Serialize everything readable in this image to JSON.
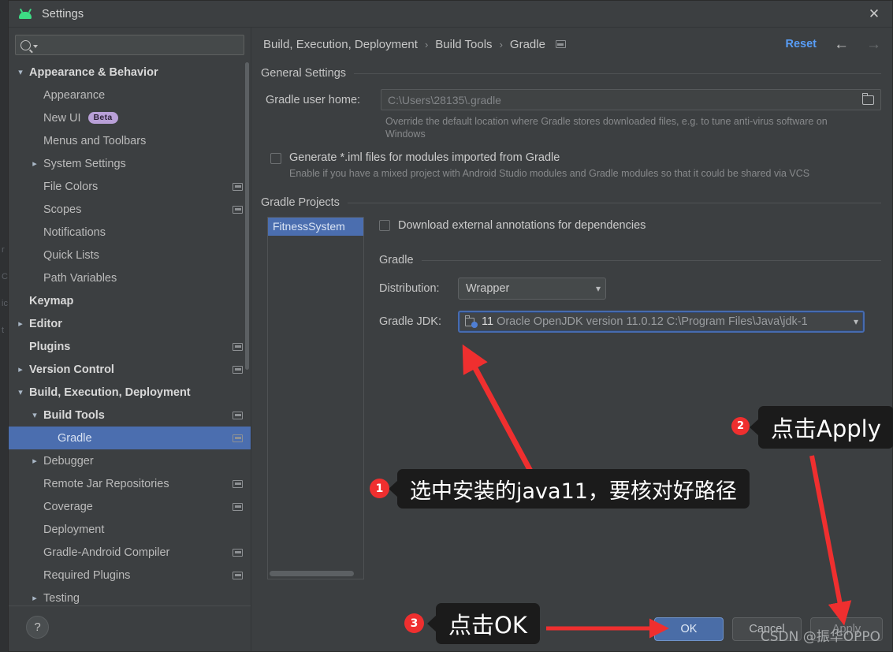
{
  "window": {
    "title": "Settings",
    "app_icon": "android-studio-icon",
    "close_icon": "close-icon"
  },
  "sidebar": {
    "search": {
      "placeholder": "",
      "value": "",
      "icon": "search-icon"
    },
    "items": [
      {
        "label": "Appearance & Behavior",
        "indent": 0,
        "arrow": "expanded",
        "bold": true,
        "cfg": false,
        "badge": ""
      },
      {
        "label": "Appearance",
        "indent": 1,
        "arrow": "none",
        "bold": false,
        "cfg": false,
        "badge": ""
      },
      {
        "label": "New UI",
        "indent": 1,
        "arrow": "none",
        "bold": false,
        "cfg": false,
        "badge": "Beta"
      },
      {
        "label": "Menus and Toolbars",
        "indent": 1,
        "arrow": "none",
        "bold": false,
        "cfg": false,
        "badge": ""
      },
      {
        "label": "System Settings",
        "indent": 1,
        "arrow": "collapsed",
        "bold": false,
        "cfg": false,
        "badge": ""
      },
      {
        "label": "File Colors",
        "indent": 1,
        "arrow": "none",
        "bold": false,
        "cfg": true,
        "badge": ""
      },
      {
        "label": "Scopes",
        "indent": 1,
        "arrow": "none",
        "bold": false,
        "cfg": true,
        "badge": ""
      },
      {
        "label": "Notifications",
        "indent": 1,
        "arrow": "none",
        "bold": false,
        "cfg": false,
        "badge": ""
      },
      {
        "label": "Quick Lists",
        "indent": 1,
        "arrow": "none",
        "bold": false,
        "cfg": false,
        "badge": ""
      },
      {
        "label": "Path Variables",
        "indent": 1,
        "arrow": "none",
        "bold": false,
        "cfg": false,
        "badge": ""
      },
      {
        "label": "Keymap",
        "indent": 0,
        "arrow": "none",
        "bold": true,
        "cfg": false,
        "badge": ""
      },
      {
        "label": "Editor",
        "indent": 0,
        "arrow": "collapsed",
        "bold": true,
        "cfg": false,
        "badge": ""
      },
      {
        "label": "Plugins",
        "indent": 0,
        "arrow": "none",
        "bold": true,
        "cfg": true,
        "badge": ""
      },
      {
        "label": "Version Control",
        "indent": 0,
        "arrow": "collapsed",
        "bold": true,
        "cfg": true,
        "badge": ""
      },
      {
        "label": "Build, Execution, Deployment",
        "indent": 0,
        "arrow": "expanded",
        "bold": true,
        "cfg": false,
        "badge": ""
      },
      {
        "label": "Build Tools",
        "indent": 1,
        "arrow": "expanded",
        "bold": true,
        "cfg": true,
        "badge": ""
      },
      {
        "label": "Gradle",
        "indent": 2,
        "arrow": "none",
        "bold": false,
        "cfg": true,
        "badge": "",
        "selected": true
      },
      {
        "label": "Debugger",
        "indent": 1,
        "arrow": "collapsed",
        "bold": false,
        "cfg": false,
        "badge": ""
      },
      {
        "label": "Remote Jar Repositories",
        "indent": 1,
        "arrow": "none",
        "bold": false,
        "cfg": true,
        "badge": ""
      },
      {
        "label": "Coverage",
        "indent": 1,
        "arrow": "none",
        "bold": false,
        "cfg": true,
        "badge": ""
      },
      {
        "label": "Deployment",
        "indent": 1,
        "arrow": "none",
        "bold": false,
        "cfg": false,
        "badge": ""
      },
      {
        "label": "Gradle-Android Compiler",
        "indent": 1,
        "arrow": "none",
        "bold": false,
        "cfg": true,
        "badge": ""
      },
      {
        "label": "Required Plugins",
        "indent": 1,
        "arrow": "none",
        "bold": false,
        "cfg": true,
        "badge": ""
      },
      {
        "label": "Testing",
        "indent": 1,
        "arrow": "collapsed",
        "bold": false,
        "cfg": false,
        "badge": ""
      }
    ],
    "help_button": "?"
  },
  "breadcrumb": {
    "crumbs": [
      "Build, Execution, Deployment",
      "Build Tools",
      "Gradle"
    ],
    "separator": "›",
    "config_icon": "settings-chip-icon",
    "reset_label": "Reset",
    "back_icon": "←",
    "forward_icon": "→"
  },
  "general_settings": {
    "title": "General Settings",
    "gradle_user_home_label": "Gradle user home:",
    "gradle_user_home_value": "C:\\Users\\28135\\.gradle",
    "gradle_user_home_hint": "Override the default location where Gradle stores downloaded files, e.g. to tune anti-virus software on Windows",
    "browse_icon": "folder-icon",
    "generate_iml_label": "Generate *.iml files for modules imported from Gradle",
    "generate_iml_checked": false,
    "generate_iml_hint": "Enable if you have a mixed project with Android Studio modules and Gradle modules so that it could be shared via VCS"
  },
  "gradle_projects": {
    "title": "Gradle Projects",
    "projects": [
      "FitnessSystem"
    ],
    "selected_project": "FitnessSystem",
    "download_annotations_label": "Download external annotations for dependencies",
    "download_annotations_checked": false,
    "gradle_group_title": "Gradle",
    "distribution_label": "Distribution:",
    "distribution_value": "Wrapper",
    "jdk_label": "Gradle JDK:",
    "jdk_version": "11",
    "jdk_value": "Oracle OpenJDK version 11.0.12  C:\\Program Files\\Java\\jdk-1",
    "jdk_icon": "jdk-folder-icon",
    "chevron_icon": "⌄"
  },
  "buttons": {
    "ok": "OK",
    "cancel": "Cancel",
    "apply": "Apply"
  },
  "annotations": {
    "step1": {
      "number": "1",
      "text": "选中安装的java11，要核对好路径"
    },
    "step2": {
      "number": "2",
      "text": "点击Apply"
    },
    "step3": {
      "number": "3",
      "text": "点击OK"
    },
    "arrow_color": "#ef2f2f"
  },
  "watermark": "CSDN @振华OPPO",
  "colors": {
    "dialog_bg": "#3c3f41",
    "selection_blue": "#4b6eaf",
    "accent_link": "#589df6",
    "callout_bg": "#1b1b1b",
    "badge_red": "#ef2f2f"
  }
}
